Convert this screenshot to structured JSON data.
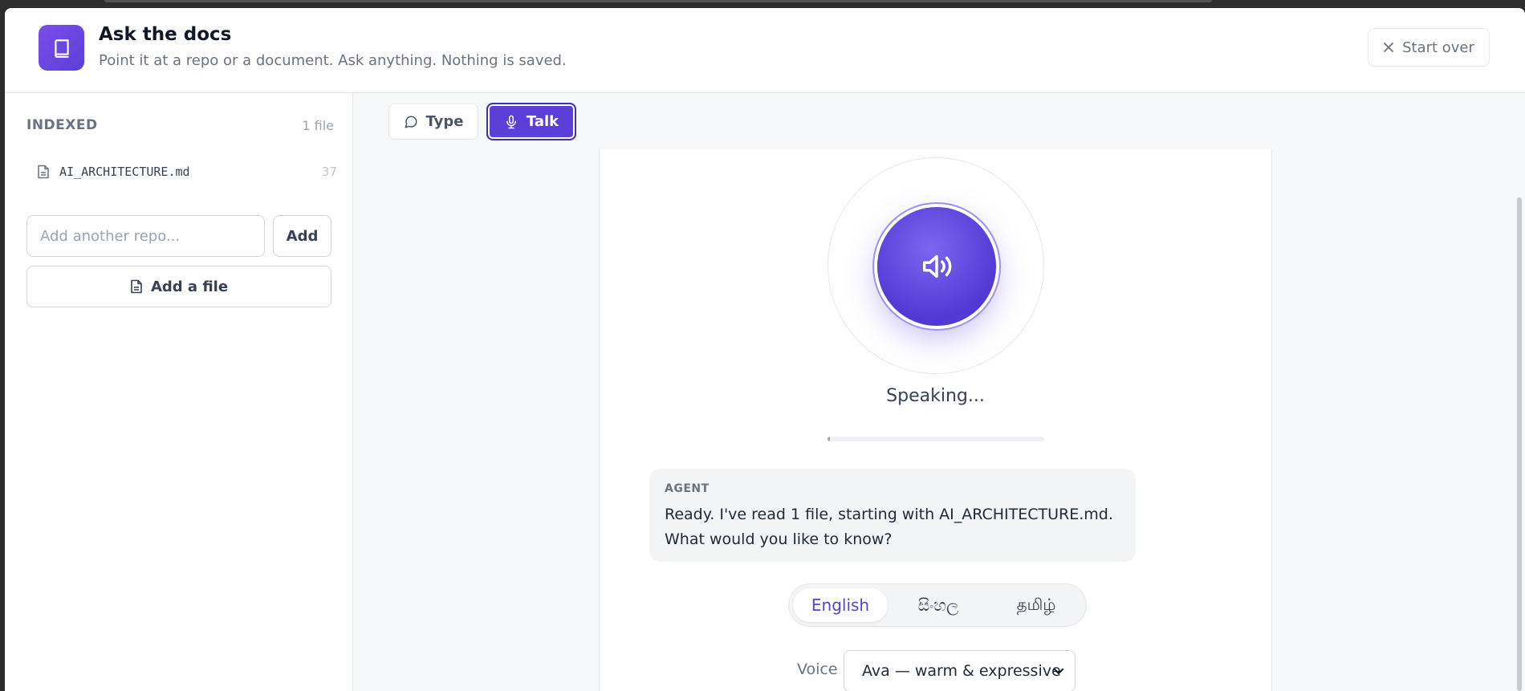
{
  "header": {
    "title": "Ask the docs",
    "subtitle": "Point it at a repo or a document. Ask anything. Nothing is saved.",
    "start_over_label": "Start over",
    "logo_icon": "book-icon"
  },
  "sidebar": {
    "section_title": "INDEXED",
    "file_count": "1 file",
    "files": [
      {
        "name": "AI_ARCHITECTURE.md",
        "count": "37",
        "icon": "file-text-icon"
      }
    ],
    "repo_placeholder": "Add another repo...",
    "add_label": "Add",
    "add_file_label": "Add a file"
  },
  "main": {
    "tabs": [
      {
        "label": "Type",
        "icon": "chat-bubble-icon",
        "active": false
      },
      {
        "label": "Talk",
        "icon": "microphone-icon",
        "active": true
      }
    ],
    "orb_icon": "speaker-icon",
    "status": "Speaking...",
    "progress": 0.01,
    "message": {
      "role": "AGENT",
      "text": "Ready. I've read 1 file, starting with AI_ARCHITECTURE.md. What would you like to know?"
    },
    "languages": [
      {
        "label": "English",
        "active": true
      },
      {
        "label": "සිංහල",
        "active": false
      },
      {
        "label": "தமிழ்",
        "active": false
      }
    ],
    "voice_label": "Voice",
    "voice_value": "Ava — warm & expressive"
  },
  "colors": {
    "accent": "#5a3fd8",
    "logo_bg": "#6d45e3"
  }
}
